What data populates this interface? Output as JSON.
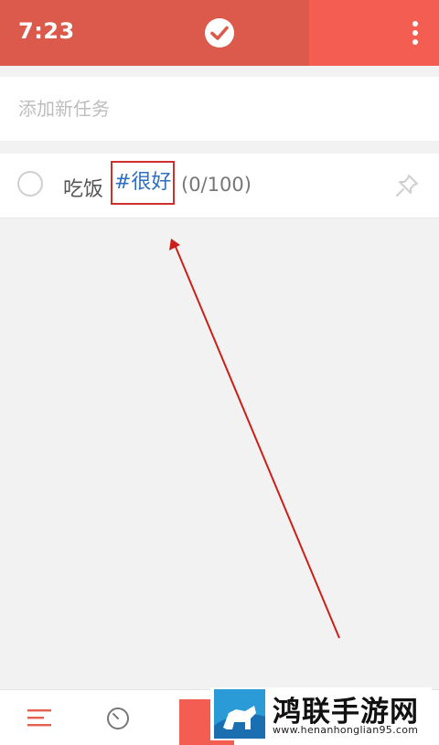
{
  "status_bar": {
    "time": "7:23"
  },
  "header": {
    "logo_icon": "check-circle-icon",
    "menu_icon": "more-vert-icon"
  },
  "add_task": {
    "placeholder": "添加新任务",
    "value": ""
  },
  "tasks": [
    {
      "name": "吃饭",
      "tag": "#很好",
      "progress": "(0/100)",
      "pin_icon": "pin-icon"
    }
  ],
  "bottom_nav": {
    "items": [
      "list-icon",
      "clock-icon",
      "add-button"
    ]
  },
  "watermark": {
    "title": "鸿联手游网",
    "url": "www.henanhonglian95.com"
  },
  "colors": {
    "header": "#dc5a4b",
    "header_right": "#f45d52",
    "accent": "#f45d52",
    "tag_text": "#2f6fbf",
    "highlight_box": "#d0302c",
    "arrow": "#cc1f1a",
    "background": "#f2f2f2"
  }
}
